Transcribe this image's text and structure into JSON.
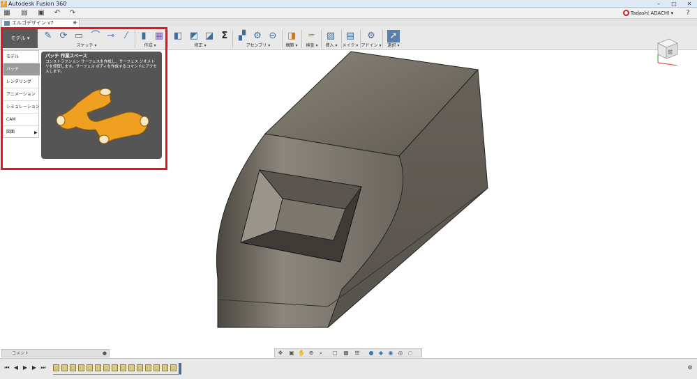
{
  "window": {
    "title": "Autodesk Fusion 360"
  },
  "quick_toolbar": {
    "icons": [
      "grid-icon",
      "file-icon",
      "save-icon",
      "undo-icon",
      "redo-icon"
    ],
    "user_name": "Tadashi ADACHI ▾"
  },
  "document_tab": {
    "label": "エルゴデザイン v7"
  },
  "ribbon": {
    "workspace_button": "モデル ▾",
    "groups": [
      {
        "label": "スケッチ ▾"
      },
      {
        "label": "作成 ▾"
      },
      {
        "label": "修正 ▾"
      },
      {
        "label": "アセンブリ ▾"
      },
      {
        "label": "構築 ▾"
      },
      {
        "label": "検査 ▾"
      },
      {
        "label": "挿入 ▾"
      },
      {
        "label": "メイク ▾"
      },
      {
        "label": "アドイン ▾"
      },
      {
        "label": "選択 ▾"
      }
    ]
  },
  "workspace_menu": {
    "items": [
      {
        "label": "モデル"
      },
      {
        "label": "パッチ"
      },
      {
        "label": "レンダリング"
      },
      {
        "label": "アニメーション"
      },
      {
        "label": "シミュレーション"
      },
      {
        "label": "CAM"
      },
      {
        "label": "図面"
      }
    ],
    "selected_index": 1
  },
  "tooltip": {
    "title": "パッチ 作業スペース",
    "description": "コンストラクション サーフェスを作成し、サーフェス ジオメトリを修復します。サーフェス ボディを作成するコマンドにアクセスします。"
  },
  "viewcube": {
    "face_label": "前"
  },
  "comment_panel": {
    "label": "コメント"
  },
  "colors": {
    "highlight": "#e8141c",
    "body": "#6e6a62",
    "tooltip_part": "#f0a020"
  }
}
